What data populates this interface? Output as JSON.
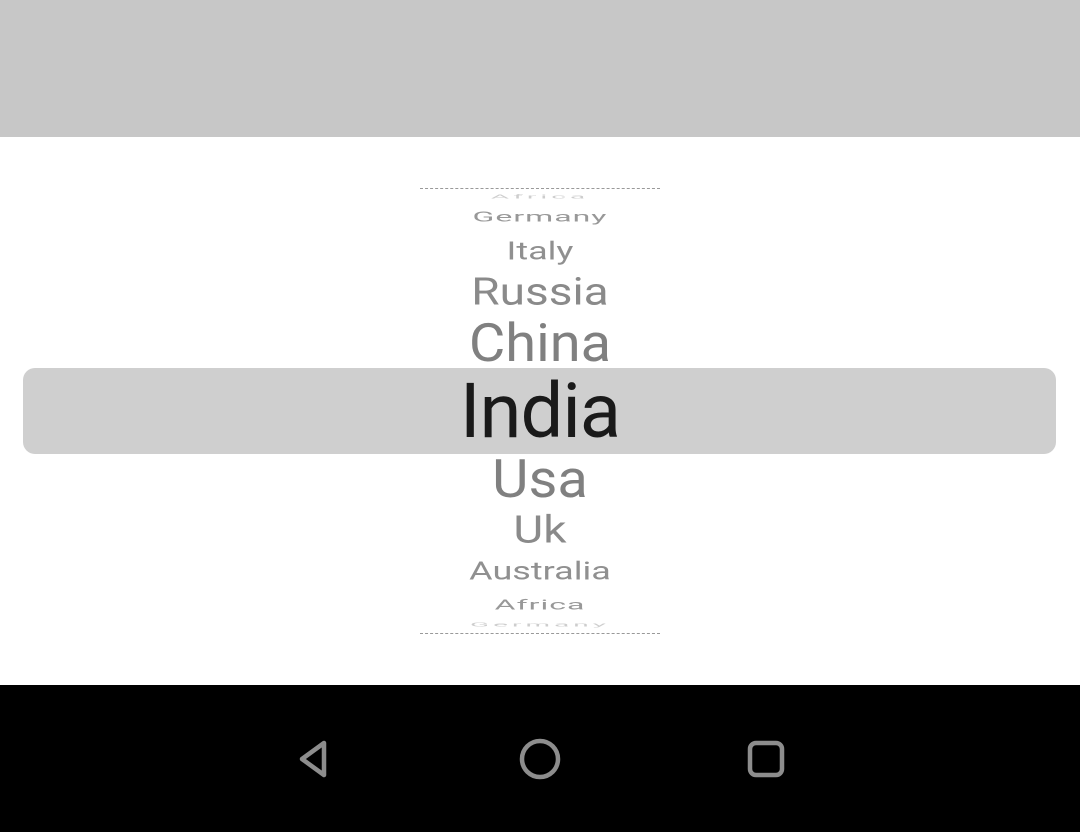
{
  "picker": {
    "items": [
      "Germany",
      "Italy",
      "Russia",
      "China",
      "India",
      "Usa",
      "Uk",
      "Australia",
      "Africa"
    ],
    "selected_index": 4,
    "edge_ghost_top": "Africa",
    "edge_ghost_bottom": "Germany"
  },
  "nav": {
    "back": "Back",
    "home": "Home",
    "recent": "Recent apps"
  }
}
